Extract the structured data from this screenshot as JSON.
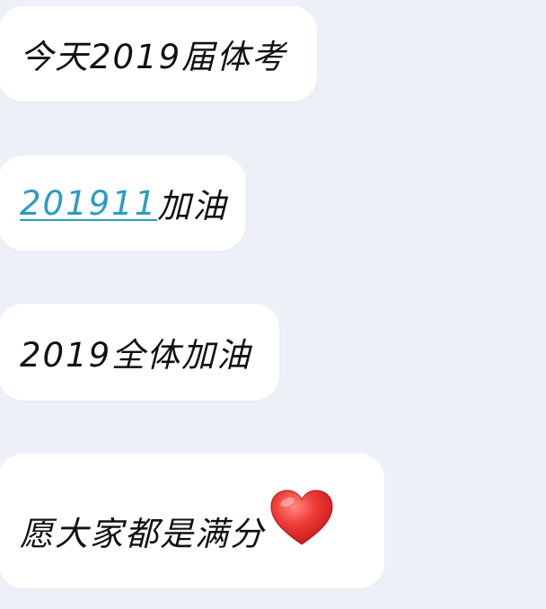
{
  "messages": [
    {
      "text": "今天2019届体考"
    },
    {
      "link_text": "201911",
      "text": "加油"
    },
    {
      "text": "2019全体加油"
    },
    {
      "text": "愿大家都是满分",
      "emoji": "red-heart"
    }
  ],
  "colors": {
    "background": "#edf1f7",
    "bubble": "#ffffff",
    "text": "#111111",
    "link": "#2a9bc3",
    "heart": "#e8322f"
  }
}
